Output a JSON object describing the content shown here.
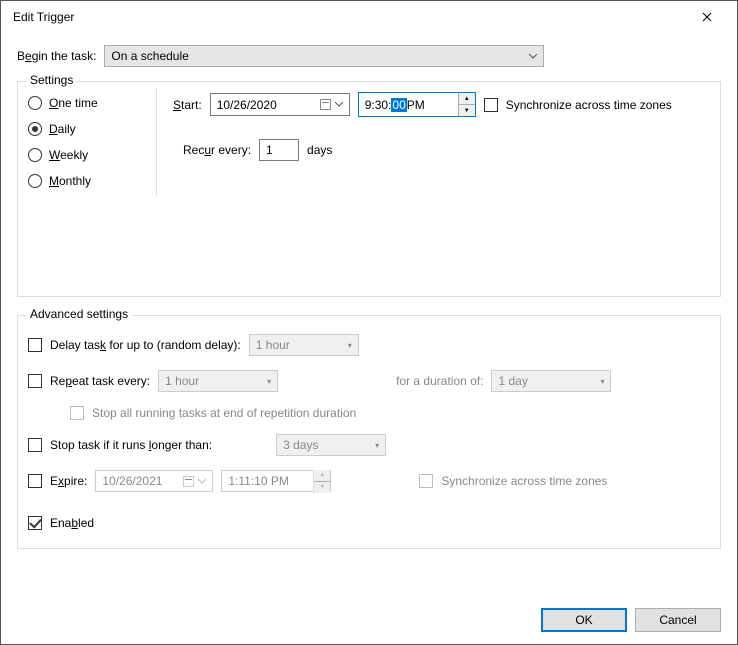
{
  "window": {
    "title": "Edit Trigger"
  },
  "begin": {
    "label": "Begin the task:",
    "value": "On a schedule"
  },
  "settings": {
    "legend": "Settings",
    "radios": {
      "one_time": "ne time",
      "daily": "aily",
      "weekly": "eekly",
      "monthly": "onthly"
    },
    "start_label": "tart:",
    "start_date": "10/26/2020",
    "start_time_pre": "9:30:",
    "start_time_sel": "00",
    "start_time_post": " PM",
    "sync_label": "Synchronize across time zones",
    "recur_label_pre": "Rec",
    "recur_label_post": "r every:",
    "recur_value": "1",
    "recur_unit": "days"
  },
  "advanced": {
    "legend": "Advanced settings",
    "delay_label_pre": "Delay tas",
    "delay_label_post": " for up to (random delay):",
    "delay_value": "1 hour",
    "repeat_label_pre": "Re",
    "repeat_label_post": "eat task every:",
    "repeat_value": "1 hour",
    "duration_label": "for a duration of:",
    "duration_value": "1 day",
    "stopall_label": "Stop all running tasks at end of repetition duration",
    "stoptask_label_pre": "Stop task if it runs ",
    "stoptask_label_post": "onger than:",
    "stoptask_value": "3 days",
    "expire_label_pre": "E",
    "expire_label_post": "pire:",
    "expire_date": "10/26/2021",
    "expire_time": "1:11:10 PM",
    "sync2_label": "Synchronize across time zones",
    "enabled_label_pre": "Ena",
    "enabled_label_post": "led"
  },
  "footer": {
    "ok": "OK",
    "cancel": "Cancel"
  }
}
